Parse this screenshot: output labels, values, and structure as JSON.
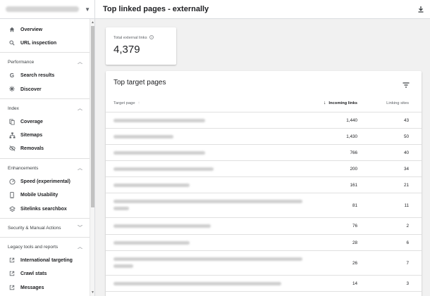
{
  "sidebar": {
    "nav_top": [
      {
        "label": "Overview",
        "icon": "home-icon"
      },
      {
        "label": "URL inspection",
        "icon": "search-icon"
      }
    ],
    "sections": [
      {
        "label": "Performance"
      },
      {
        "label": "Index"
      },
      {
        "label": "Enhancements"
      },
      {
        "label": "Security & Manual Actions"
      },
      {
        "label": "Legacy tools and reports"
      }
    ],
    "performance_items": [
      {
        "label": "Search results",
        "icon": "google-g-icon"
      },
      {
        "label": "Discover",
        "icon": "asterisk-icon"
      }
    ],
    "index_items": [
      {
        "label": "Coverage",
        "icon": "copy-icon"
      },
      {
        "label": "Sitemaps",
        "icon": "sitemap-icon"
      },
      {
        "label": "Removals",
        "icon": "eye-off-icon"
      }
    ],
    "enhancement_items": [
      {
        "label": "Speed (experimental)",
        "icon": "speed-icon"
      },
      {
        "label": "Mobile Usability",
        "icon": "phone-icon"
      },
      {
        "label": "Sitelinks searchbox",
        "icon": "layers-icon"
      }
    ],
    "legacy_items": [
      {
        "label": "International targeting",
        "icon": "external-link-icon"
      },
      {
        "label": "Crawl stats",
        "icon": "external-link-icon"
      },
      {
        "label": "Messages",
        "icon": "external-link-icon"
      }
    ]
  },
  "header": {
    "title": "Top linked pages - externally"
  },
  "stat": {
    "label": "Total external links",
    "value": "4,379"
  },
  "table": {
    "title": "Top target pages",
    "columns": {
      "page": "Target page",
      "incoming": "Incoming links",
      "linking": "Linking sites"
    },
    "rows": [
      {
        "incoming": "1,440",
        "linking": "43"
      },
      {
        "incoming": "1,430",
        "linking": "50"
      },
      {
        "incoming": "766",
        "linking": "40"
      },
      {
        "incoming": "200",
        "linking": "34"
      },
      {
        "incoming": "161",
        "linking": "21"
      },
      {
        "incoming": "81",
        "linking": "11"
      },
      {
        "incoming": "76",
        "linking": "2"
      },
      {
        "incoming": "28",
        "linking": "6"
      },
      {
        "incoming": "26",
        "linking": "7"
      },
      {
        "incoming": "14",
        "linking": "3"
      }
    ]
  }
}
